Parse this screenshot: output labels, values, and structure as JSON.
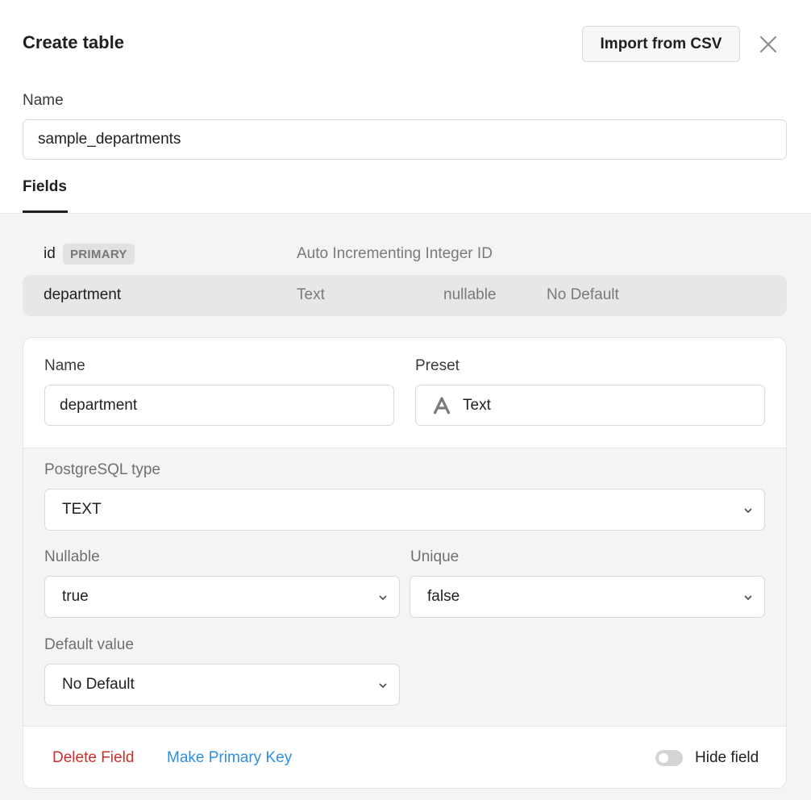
{
  "dialog": {
    "title": "Create table",
    "import_button": "Import from CSV",
    "name_label": "Name",
    "name_value": "sample_departments",
    "tab_fields": "Fields"
  },
  "fields": [
    {
      "name": "id",
      "badge": "PRIMARY",
      "type": "Auto Incrementing Integer ID"
    },
    {
      "name": "department",
      "type": "Text",
      "nullable": "nullable",
      "default": "No Default"
    }
  ],
  "editor": {
    "name_label": "Name",
    "name_value": "department",
    "preset_label": "Preset",
    "preset_value": "Text",
    "pg_type_label": "PostgreSQL type",
    "pg_type_value": "TEXT",
    "nullable_label": "Nullable",
    "nullable_value": "true",
    "unique_label": "Unique",
    "unique_value": "false",
    "default_label": "Default value",
    "default_value": "No Default",
    "delete_label": "Delete Field",
    "make_primary_label": "Make Primary Key",
    "hide_label": "Hide field",
    "hide_enabled": false
  },
  "colors": {
    "danger": "#c9302c",
    "link": "#2f8fdf"
  }
}
